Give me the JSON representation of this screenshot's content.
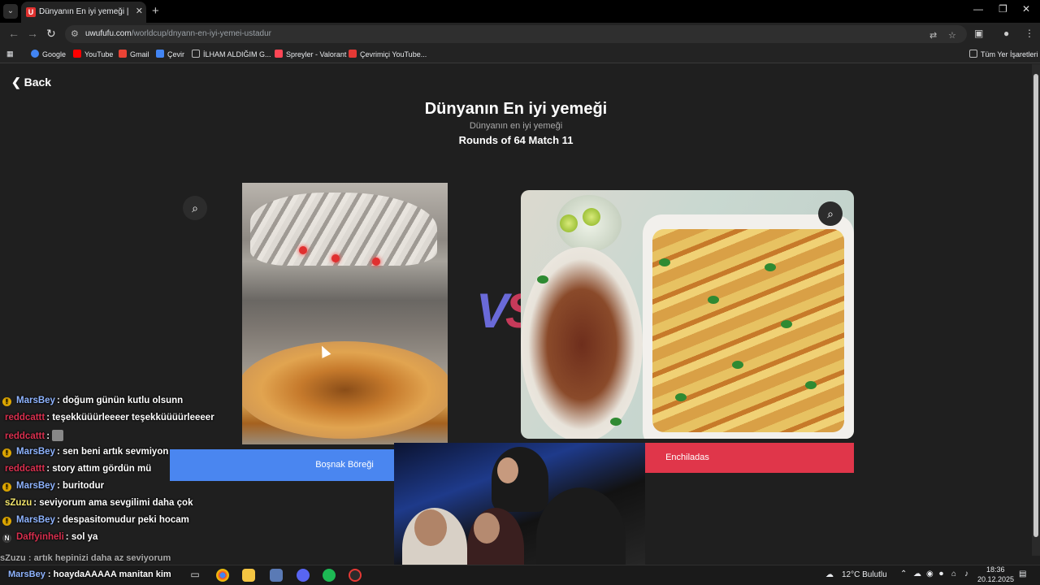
{
  "browser": {
    "tab_title": "Dünyanın En iyi yemeği | UwUF",
    "tab_favicon": "U",
    "url_domain": "uwufufu.com",
    "url_path": "/worldcup/dnyann-en-iyi-yemei-ustadur"
  },
  "bookmarks": [
    {
      "label": "Google",
      "icon": "google-icon",
      "color": "#4285f4"
    },
    {
      "label": "YouTube",
      "icon": "youtube-icon",
      "color": "#ff0000"
    },
    {
      "label": "Gmail",
      "icon": "gmail-icon",
      "color": "#ea4335"
    },
    {
      "label": "Çevir",
      "icon": "translate-icon",
      "color": "#4285f4"
    },
    {
      "label": "İLHAM ALDIĞIM G...",
      "icon": "folder-icon",
      "color": "#bbbbbb"
    },
    {
      "label": "Spreyler - Valorant",
      "icon": "valorant-icon",
      "color": "#ff4655"
    },
    {
      "label": "Çevrimiçi YouTube...",
      "icon": "bookmark-icon",
      "color": "#e53935"
    },
    {
      "label": "Tüm Yer İşaretleri",
      "icon": "folder-icon",
      "color": "#bbbbbb"
    }
  ],
  "page": {
    "back_label": "Back",
    "title": "Dünyanın En iyi yemeği",
    "subtitle": "Dünyanın en iyi yemeği",
    "round_info": "Rounds of 64 Match 11",
    "vs_v": "V",
    "vs_s": "S",
    "left_choice": "Boşnak Böreği",
    "right_choice": "Enchiladas"
  },
  "chat": [
    {
      "badge": true,
      "user": "MarsBey",
      "user_color": "#8fb4ff",
      "message": ": doğum günün kutlu olsunn"
    },
    {
      "badge": false,
      "user": "reddcattt",
      "user_color": "#d9304f",
      "message": ": teşekküüürleeeer teşekküüüürleeeer"
    },
    {
      "badge": false,
      "user": "reddcattt",
      "user_color": "#d9304f",
      "message": ":"
    },
    {
      "badge": true,
      "user": "MarsBey",
      "user_color": "#8fb4ff",
      "message": ": sen beni artık sevmiyon"
    },
    {
      "badge": false,
      "user": "reddcattt",
      "user_color": "#d9304f",
      "message": ": story attım gördün mü"
    },
    {
      "badge": true,
      "user": "MarsBey",
      "user_color": "#8fb4ff",
      "message": ": buritodur"
    },
    {
      "badge": false,
      "user": "sZuzu",
      "user_color": "#f2e56b",
      "message": ": seviyorum ama sevgilimi daha çok"
    },
    {
      "badge": true,
      "user": "MarsBey",
      "user_color": "#8fb4ff",
      "message": ": despasitomudur peki hocam"
    },
    {
      "badge": false,
      "user": "Daffyinheli",
      "user_color": "#d9304f",
      "message": ": sol ya"
    }
  ],
  "chat_overflow": [
    {
      "user": "sZuzu",
      "message": ": artık hepinizi daha az seviyorum"
    },
    {
      "user": "MarsBey",
      "message": ": hoaydaAAAAA manitan kim"
    }
  ],
  "taskbar": {
    "weather": "12°C  Bulutlu",
    "time": "18:36",
    "date": "20.12.2025"
  }
}
